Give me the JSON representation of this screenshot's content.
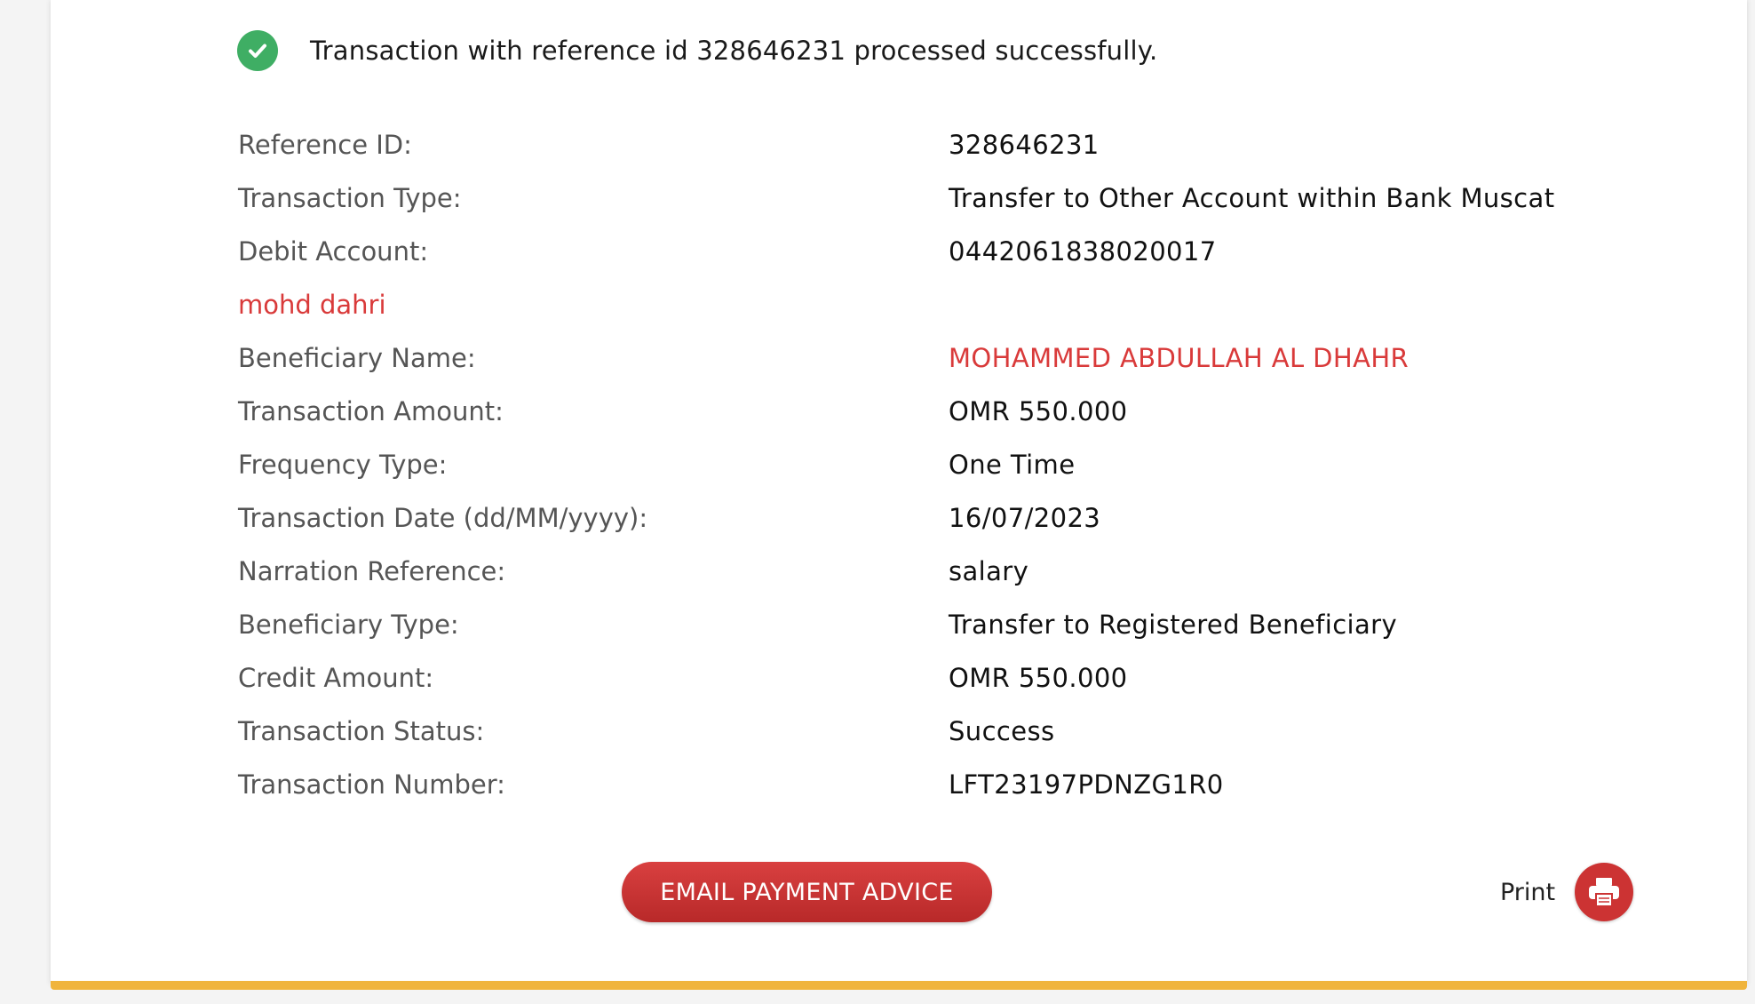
{
  "success_message": "Transaction with reference id 328646231 processed successfully.",
  "details": [
    {
      "label": "Reference ID:",
      "value": "328646231"
    },
    {
      "label": "Transaction Type:",
      "value": "Transfer to Other Account within Bank Muscat"
    },
    {
      "label": "Debit Account:",
      "value": "0442061838020017"
    },
    {
      "label": "mohd dahri",
      "value": ""
    },
    {
      "label": "Beneficiary Name:",
      "value": "MOHAMMED ABDULLAH AL DHAHR"
    },
    {
      "label": "Transaction Amount:",
      "value": "OMR 550.000"
    },
    {
      "label": "Frequency Type:",
      "value": "One Time"
    },
    {
      "label": "Transaction Date (dd/MM/yyyy):",
      "value": "16/07/2023"
    },
    {
      "label": "Narration Reference:",
      "value": "salary"
    },
    {
      "label": "Beneficiary Type:",
      "value": "Transfer to Registered Beneficiary"
    },
    {
      "label": "Credit Amount:",
      "value": "OMR 550.000"
    },
    {
      "label": "Transaction Status:",
      "value": "Success"
    },
    {
      "label": "Transaction Number:",
      "value": "LFT23197PDNZG1R0"
    }
  ],
  "actions": {
    "email_button_label": "EMAIL PAYMENT ADVICE",
    "print_label": "Print"
  },
  "colors": {
    "accent_red": "#d93a3a",
    "success_green": "#3fae64",
    "bottom_bar": "#f0b43c"
  },
  "icons": {
    "success": "check-circle-icon",
    "print": "printer-icon"
  }
}
